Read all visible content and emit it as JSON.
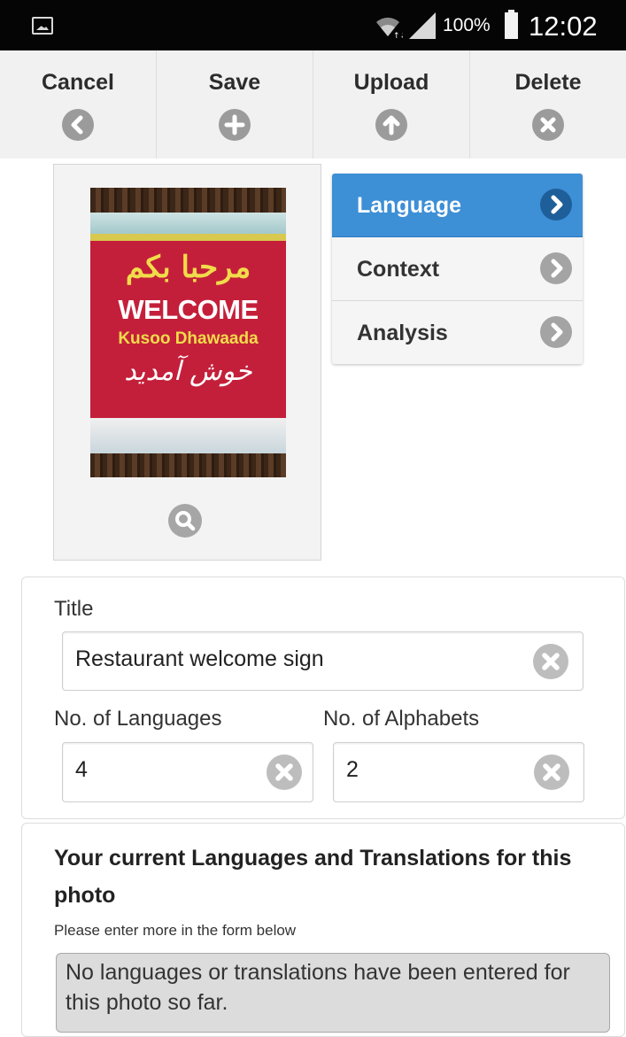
{
  "status_bar": {
    "battery_percent": "100%",
    "time": "12:02"
  },
  "toolbar": {
    "cancel_label": "Cancel",
    "save_label": "Save",
    "upload_label": "Upload",
    "delete_label": "Delete"
  },
  "photo": {
    "sign_text_english": "WELCOME",
    "sign_text_somali": "Kusoo Dhawaada",
    "sign_text_arabic": "مرحبا بكم",
    "sign_text_persian": "خوش آمدید"
  },
  "menu": {
    "items": [
      {
        "label": "Language",
        "active": true
      },
      {
        "label": "Context",
        "active": false
      },
      {
        "label": "Analysis",
        "active": false
      }
    ]
  },
  "form": {
    "title_label": "Title",
    "title_value": "Restaurant welcome sign",
    "languages_label": "No. of Languages",
    "languages_value": "4",
    "alphabets_label": "No. of Alphabets",
    "alphabets_value": "2"
  },
  "languages_panel": {
    "heading": "Your current Languages and Translations for this photo",
    "hint": "Please enter more in the form below",
    "empty_message": "No languages or translations have been entered for this photo so far."
  },
  "colors": {
    "accent": "#3d8fd6",
    "status_bar": "#050505",
    "toolbar_bg": "#f1f1f1"
  }
}
